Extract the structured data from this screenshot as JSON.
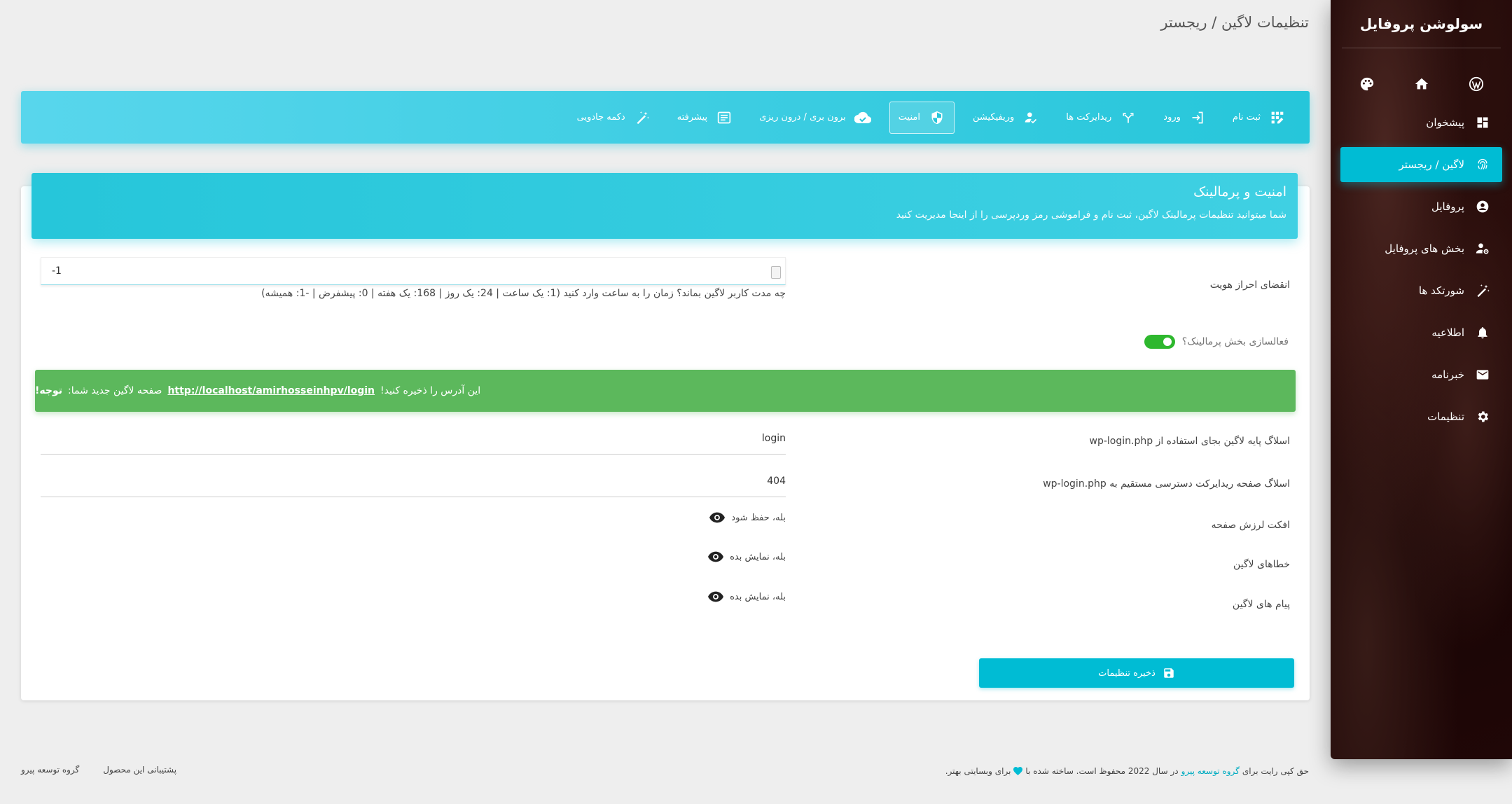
{
  "page_title": "تنظیمات لاگین / ریجستر",
  "sidebar": {
    "title": "سولوشن پروفایل",
    "quick_icons": [
      "wordpress-icon",
      "home-icon",
      "palette-icon"
    ],
    "items": [
      {
        "label": "پیشخوان",
        "icon": "dashboard-icon"
      },
      {
        "label": "لاگین / ریجستر",
        "icon": "fingerprint-icon",
        "active": true
      },
      {
        "label": "پروفایل",
        "icon": "account-circle-icon"
      },
      {
        "label": "بخش های پروفایل",
        "icon": "person-gear-icon"
      },
      {
        "label": "شورتکد ها",
        "icon": "magic-wand-icon"
      },
      {
        "label": "اطلاعیه",
        "icon": "bell-icon"
      },
      {
        "label": "خبرنامه",
        "icon": "mail-icon"
      },
      {
        "label": "تنظیمات",
        "icon": "gear-icon"
      }
    ]
  },
  "tabs": [
    {
      "label": "ثبت نام",
      "icon": "app-registration-icon"
    },
    {
      "label": "ورود",
      "icon": "login-icon"
    },
    {
      "label": "ریدایرکت ها",
      "icon": "fork-arrows-icon"
    },
    {
      "label": "وریفیکیشن",
      "icon": "verified-user-icon"
    },
    {
      "label": "امنیت",
      "icon": "shield-icon",
      "active": true
    },
    {
      "label": "برون بری / درون ریزی",
      "icon": "cloud-icon"
    },
    {
      "label": "پیشرفته",
      "icon": "article-icon"
    },
    {
      "label": "دکمه جادویی",
      "icon": "magic-wand-icon"
    }
  ],
  "section": {
    "title": "امنیت و پرمالینک",
    "subtitle": "شما میتوانید تنظیمات پرمالینک لاگین، ثبت نام و فراموشی رمز وردپرسی را از اینجا مدیریت کنید"
  },
  "auth_expiry": {
    "label": "انقضای احراز هویت",
    "value": "-1",
    "help": "چه مدت کاربر لاگین بماند؟ زمان را به ساعت وارد کنید (1: یک ساعت | 24: یک روز | 168: یک هفته | 0: پیشفرض | -1: همیشه)"
  },
  "permalink_toggle": {
    "label": "فعالسازی بخش پرمالینک؟",
    "enabled": true
  },
  "notice": {
    "bold": "توجه!",
    "before": "صفحه لاگین جدید شما:",
    "link": "http://localhost/amirhosseinhpv/login",
    "after": "این آدرس را ذخیره کنید!",
    "color": "#5cb85c"
  },
  "login_slug": {
    "label": "اسلاگ پایه لاگین بجای استفاده از wp-login.php",
    "value": "login"
  },
  "redirect_slug": {
    "label": "اسلاگ صفحه ریدایرکت دسترسی مستقیم به wp-login.php",
    "value": "404"
  },
  "shake_effect": {
    "label": "افکت لرزش صفحه",
    "value": "بله، حفظ شود"
  },
  "login_errors": {
    "label": "خطاهای لاگین",
    "value": "بله، نمایش بده"
  },
  "login_messages": {
    "label": "پیام های لاگین",
    "value": "بله، نمایش بده"
  },
  "save_button": "ذخیره تنظیمات",
  "footer": {
    "copyright_before": "حق کپی رایت برای",
    "copyright_link": "گروه توسعه پیرو",
    "copyright_after": "در سال 2022 محفوظ است. ساخته شده با",
    "copyright_end": "برای وبسایتی بهتر.",
    "links": [
      "پشتیبانی این محصول",
      "گروه توسعه پیرو"
    ]
  },
  "colors": {
    "accent": "#00bcd4",
    "success": "#5cb85c",
    "toggle": "#2eb82e",
    "sidebar_bg": "#1e0606"
  }
}
